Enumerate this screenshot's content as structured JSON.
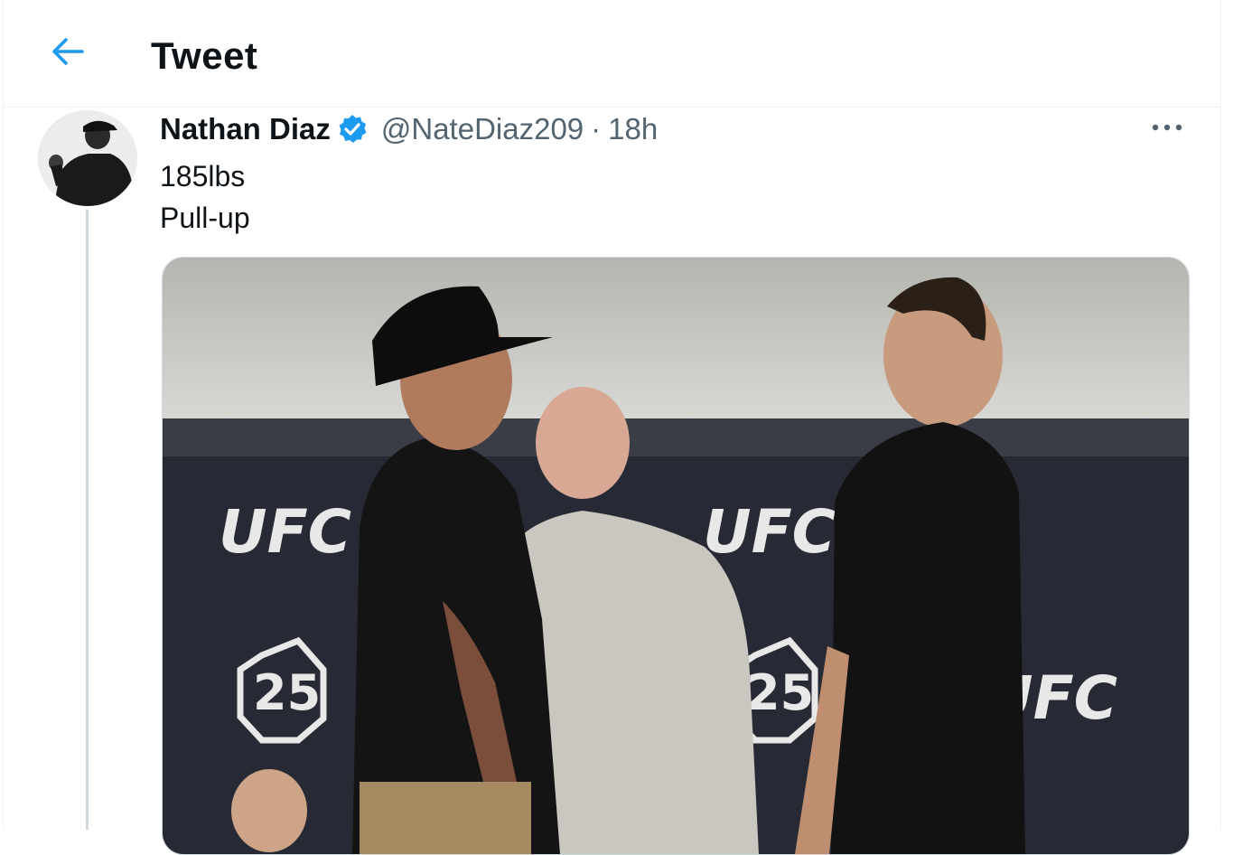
{
  "header": {
    "title": "Tweet",
    "back_icon": "arrow-left-icon"
  },
  "tweet": {
    "author": {
      "display_name": "Nathan Diaz",
      "handle": "@NateDiaz209",
      "verified": true,
      "verified_icon": "verified-badge-icon"
    },
    "separator": "·",
    "time": "18h",
    "text_lines": [
      "185lbs",
      "Pull-up"
    ],
    "more_icon": "more-dots-icon",
    "media": {
      "banner_text": "UFC",
      "anniversary_text": "25"
    }
  },
  "colors": {
    "accent": "#1d9bf0",
    "secondary_text": "#536471",
    "primary_text": "#0f1419",
    "border": "#eff3f4"
  }
}
